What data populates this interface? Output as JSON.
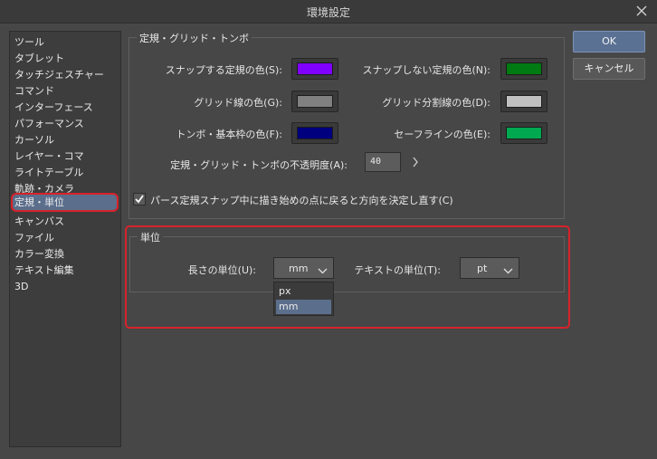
{
  "window": {
    "title": "環境設定"
  },
  "sidebar": {
    "items": [
      {
        "label": "ツール"
      },
      {
        "label": "タブレット"
      },
      {
        "label": "タッチジェスチャー"
      },
      {
        "label": "コマンド"
      },
      {
        "label": "インターフェース"
      },
      {
        "label": "パフォーマンス"
      },
      {
        "label": "カーソル"
      },
      {
        "label": "レイヤー・コマ"
      },
      {
        "label": "ライトテーブル"
      },
      {
        "label": "軌跡・カメラ"
      },
      {
        "label": "定規・単位",
        "selected": true
      },
      {
        "label": "キャンバス"
      },
      {
        "label": "ファイル"
      },
      {
        "label": "カラー変換"
      },
      {
        "label": "テキスト編集"
      },
      {
        "label": "3D"
      }
    ]
  },
  "ruler_group": {
    "title": "定規・グリッド・トンボ",
    "snap_color": {
      "label": "スナップする定規の色(S):",
      "color": "#8000ff"
    },
    "nosnap_color": {
      "label": "スナップしない定規の色(N):",
      "color": "#007a12"
    },
    "grid_color": {
      "label": "グリッド線の色(G):",
      "color": "#808080"
    },
    "grid_div_color": {
      "label": "グリッド分割線の色(D):",
      "color": "#c0c0c0"
    },
    "tombo_color": {
      "label": "トンボ・基本枠の色(F):",
      "color": "#00007f"
    },
    "safe_color": {
      "label": "セーフラインの色(E):",
      "color": "#00a84f"
    },
    "opacity": {
      "label": "定規・グリッド・トンボの不透明度(A):",
      "value": "40"
    },
    "perspective": {
      "label": "パース定規スナップ中に描き始めの点に戻ると方向を決定し直す(C)",
      "checked": true
    }
  },
  "unit_group": {
    "title": "単位",
    "length_unit": {
      "label": "長さの単位(U):",
      "value": "mm",
      "options": [
        "px",
        "mm"
      ],
      "highlighted": "mm"
    },
    "text_unit": {
      "label": "テキストの単位(T):",
      "value": "pt"
    }
  },
  "buttons": {
    "ok": "OK",
    "cancel": "キャンセル"
  },
  "colors": {
    "accent": "#5b6e8c",
    "highlight_frame": "#d7222a",
    "background": "#474747"
  }
}
